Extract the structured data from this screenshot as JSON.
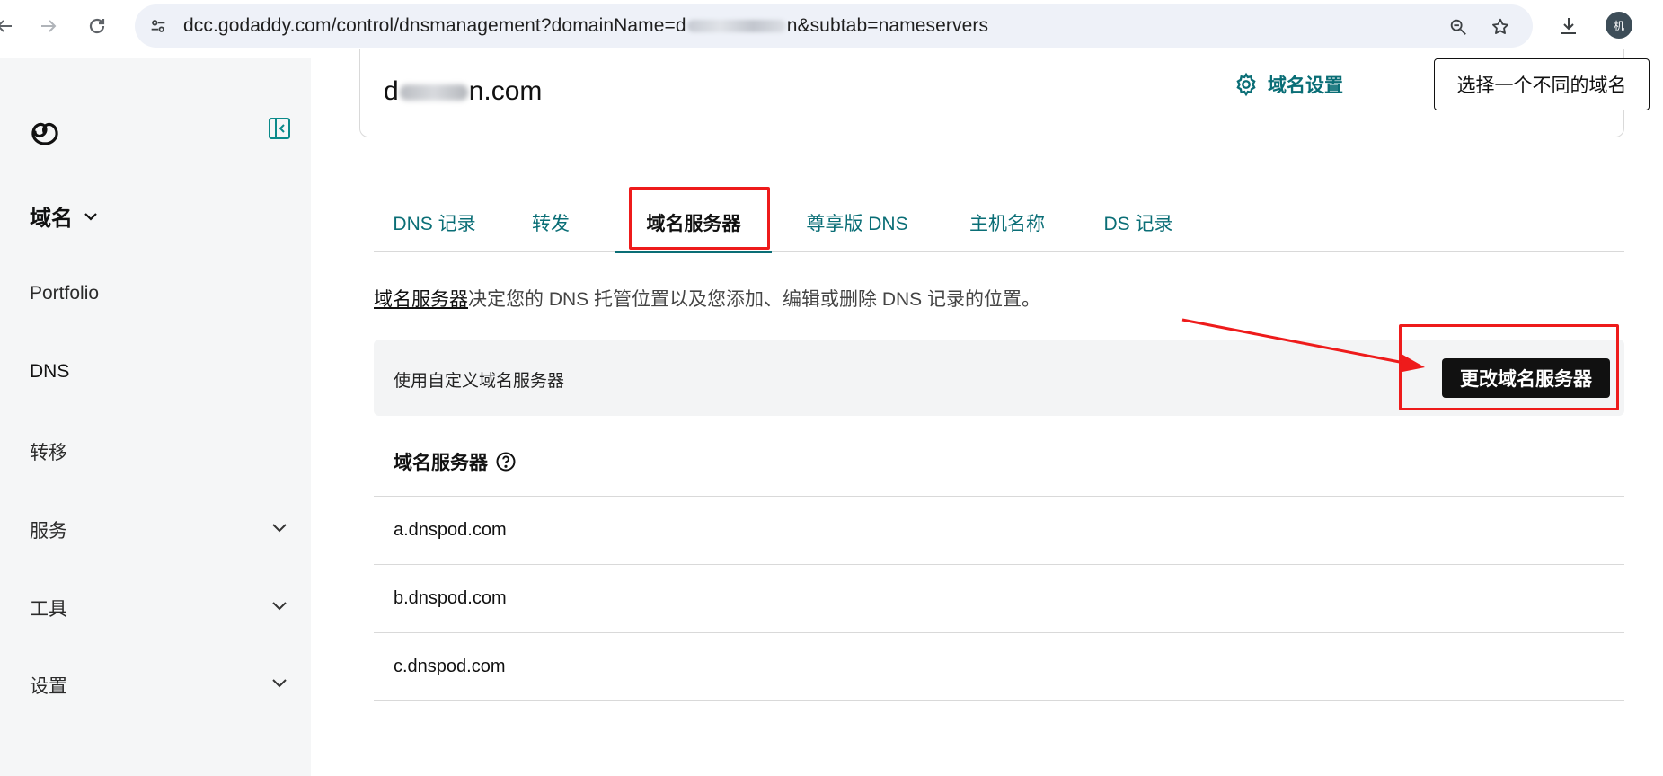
{
  "browser": {
    "url_prefix": "dcc.godaddy.com/control/dnsmanagement?domainName=",
    "url_prefix_char": "d",
    "url_suffix_char": "n",
    "url_suffix": "&subtab=nameservers",
    "profile_initial": "机"
  },
  "sidebar": {
    "section_title": "域名",
    "items": [
      {
        "label": "Portfolio"
      },
      {
        "label": "DNS"
      },
      {
        "label": "转移"
      },
      {
        "label": "服务"
      },
      {
        "label": "工具"
      },
      {
        "label": "设置"
      }
    ]
  },
  "domain_card": {
    "name_first": "d",
    "name_last": "n.com",
    "settings_label": "域名设置",
    "choose_label": "选择一个不同的域名"
  },
  "tabs": [
    {
      "label": "DNS 记录"
    },
    {
      "label": "转发"
    },
    {
      "label": "域名服务器",
      "active": true
    },
    {
      "label": "尊享版 DNS"
    },
    {
      "label": "主机名称"
    },
    {
      "label": "DS 记录"
    }
  ],
  "description": {
    "link": "域名服务器",
    "text": "决定您的 DNS 托管位置以及您添加、编辑或删除 DNS 记录的位置。"
  },
  "custom_ns": {
    "label": "使用自定义域名服务器",
    "button": "更改域名服务器"
  },
  "nameservers": {
    "header": "域名服务器",
    "rows": [
      "a.dnspod.com",
      "b.dnspod.com",
      "c.dnspod.com"
    ]
  },
  "colors": {
    "accent": "#0a6e76",
    "annotation": "#ee1b1b",
    "sidebar_bg": "#f5f6f7"
  }
}
